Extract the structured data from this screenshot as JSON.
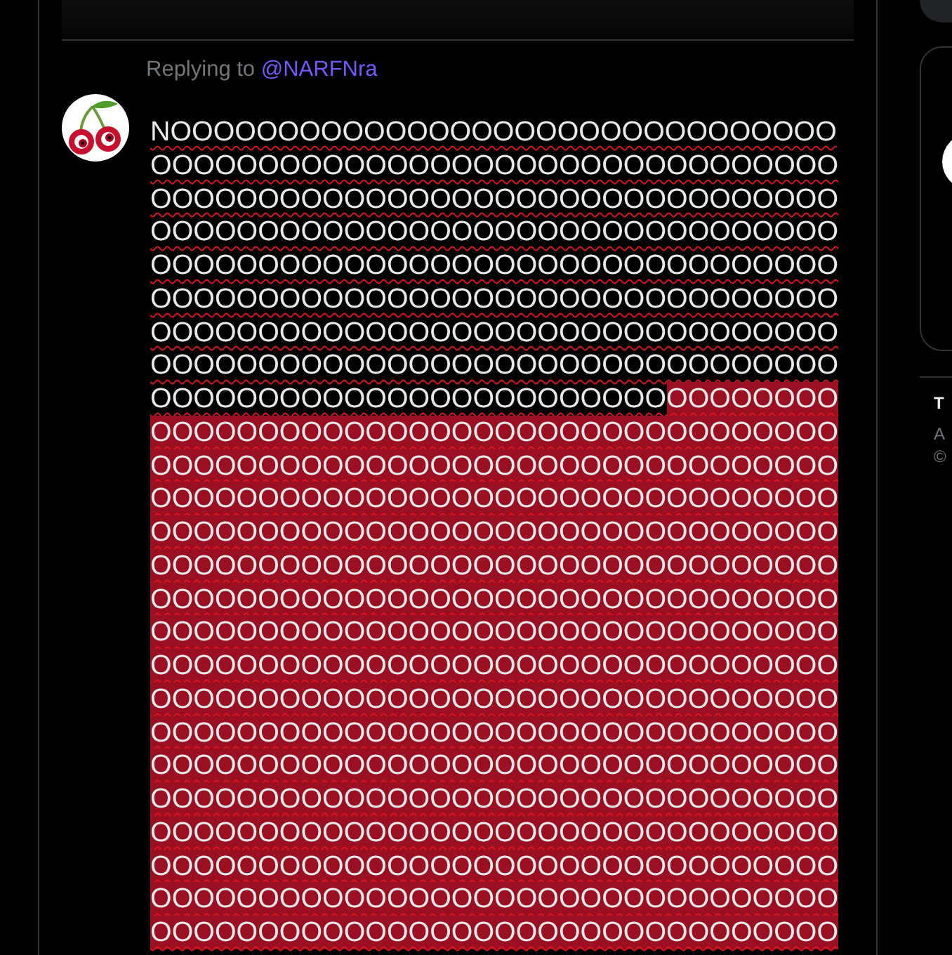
{
  "replying_to": {
    "label": "Replying to",
    "handle": "@NARFNra"
  },
  "reply": {
    "lines": [
      {
        "segments": [
          {
            "text": "NOOOOOOOOOOOOOOOOOOOOOOOOOOOOOOO",
            "over_limit": false
          }
        ]
      },
      {
        "segments": [
          {
            "text": "OOOOOOOOOOOOOOOOOOOOOOOOOOOOOOOO",
            "over_limit": false
          }
        ]
      },
      {
        "segments": [
          {
            "text": "OOOOOOOOOOOOOOOOOOOOOOOOOOOOOOOO",
            "over_limit": false
          }
        ]
      },
      {
        "segments": [
          {
            "text": "OOOOOOOOOOOOOOOOOOOOOOOOOOOOOOOO",
            "over_limit": false
          }
        ]
      },
      {
        "segments": [
          {
            "text": "OOOOOOOOOOOOOOOOOOOOOOOOOOOOOOOO",
            "over_limit": false
          }
        ]
      },
      {
        "segments": [
          {
            "text": "OOOOOOOOOOOOOOOOOOOOOOOOOOOOOOOO",
            "over_limit": false
          }
        ]
      },
      {
        "segments": [
          {
            "text": "OOOOOOOOOOOOOOOOOOOOOOOOOOOOOOOO",
            "over_limit": false
          }
        ]
      },
      {
        "segments": [
          {
            "text": "OOOOOOOOOOOOOOOOOOOOOOOOOOOOOOOO",
            "over_limit": false
          }
        ]
      },
      {
        "segments": [
          {
            "text": "OOOOOOOOOOOOOOOOOOOOOOOO",
            "over_limit": false
          },
          {
            "text": "OOOOOOOO",
            "over_limit": true
          }
        ]
      },
      {
        "segments": [
          {
            "text": "OOOOOOOOOOOOOOOOOOOOOOOOOOOOOOOO",
            "over_limit": true
          }
        ]
      },
      {
        "segments": [
          {
            "text": "OOOOOOOOOOOOOOOOOOOOOOOOOOOOOOOO",
            "over_limit": true
          }
        ]
      },
      {
        "segments": [
          {
            "text": "OOOOOOOOOOOOOOOOOOOOOOOOOOOOOOOO",
            "over_limit": true
          }
        ]
      },
      {
        "segments": [
          {
            "text": "OOOOOOOOOOOOOOOOOOOOOOOOOOOOOOOO",
            "over_limit": true
          }
        ]
      },
      {
        "segments": [
          {
            "text": "OOOOOOOOOOOOOOOOOOOOOOOOOOOOOOOO",
            "over_limit": true
          }
        ]
      },
      {
        "segments": [
          {
            "text": "OOOOOOOOOOOOOOOOOOOOOOOOOOOOOOOO",
            "over_limit": true
          }
        ]
      },
      {
        "segments": [
          {
            "text": "OOOOOOOOOOOOOOOOOOOOOOOOOOOOOOOO",
            "over_limit": true
          }
        ]
      },
      {
        "segments": [
          {
            "text": "OOOOOOOOOOOOOOOOOOOOOOOOOOOOOOOO",
            "over_limit": true
          }
        ]
      },
      {
        "segments": [
          {
            "text": "OOOOOOOOOOOOOOOOOOOOOOOOOOOOOOOO",
            "over_limit": true
          }
        ]
      },
      {
        "segments": [
          {
            "text": "OOOOOOOOOOOOOOOOOOOOOOOOOOOOOOOO",
            "over_limit": true
          }
        ]
      },
      {
        "segments": [
          {
            "text": "OOOOOOOOOOOOOOOOOOOOOOOOOOOOOOOO",
            "over_limit": true
          }
        ]
      },
      {
        "segments": [
          {
            "text": "OOOOOOOOOOOOOOOOOOOOOOOOOOOOOOOO",
            "over_limit": true
          }
        ]
      },
      {
        "segments": [
          {
            "text": "OOOOOOOOOOOOOOOOOOOOOOOOOOOOOOOO",
            "over_limit": true
          }
        ]
      },
      {
        "segments": [
          {
            "text": "OOOOOOOOOOOOOOOOOOOOOOOOOOOOOOOO",
            "over_limit": true
          }
        ]
      },
      {
        "segments": [
          {
            "text": "OOOOOOOOOOOOOOOOOOOOOOOOOOOOOOOO",
            "over_limit": true
          }
        ]
      },
      {
        "segments": [
          {
            "text": "OOOOOOOOOOOOOOOOOOOOOOOOOOOOOOOO",
            "over_limit": true
          }
        ]
      }
    ]
  },
  "sidebar": {
    "footer_lines": [
      "T",
      "A",
      "©"
    ]
  }
}
